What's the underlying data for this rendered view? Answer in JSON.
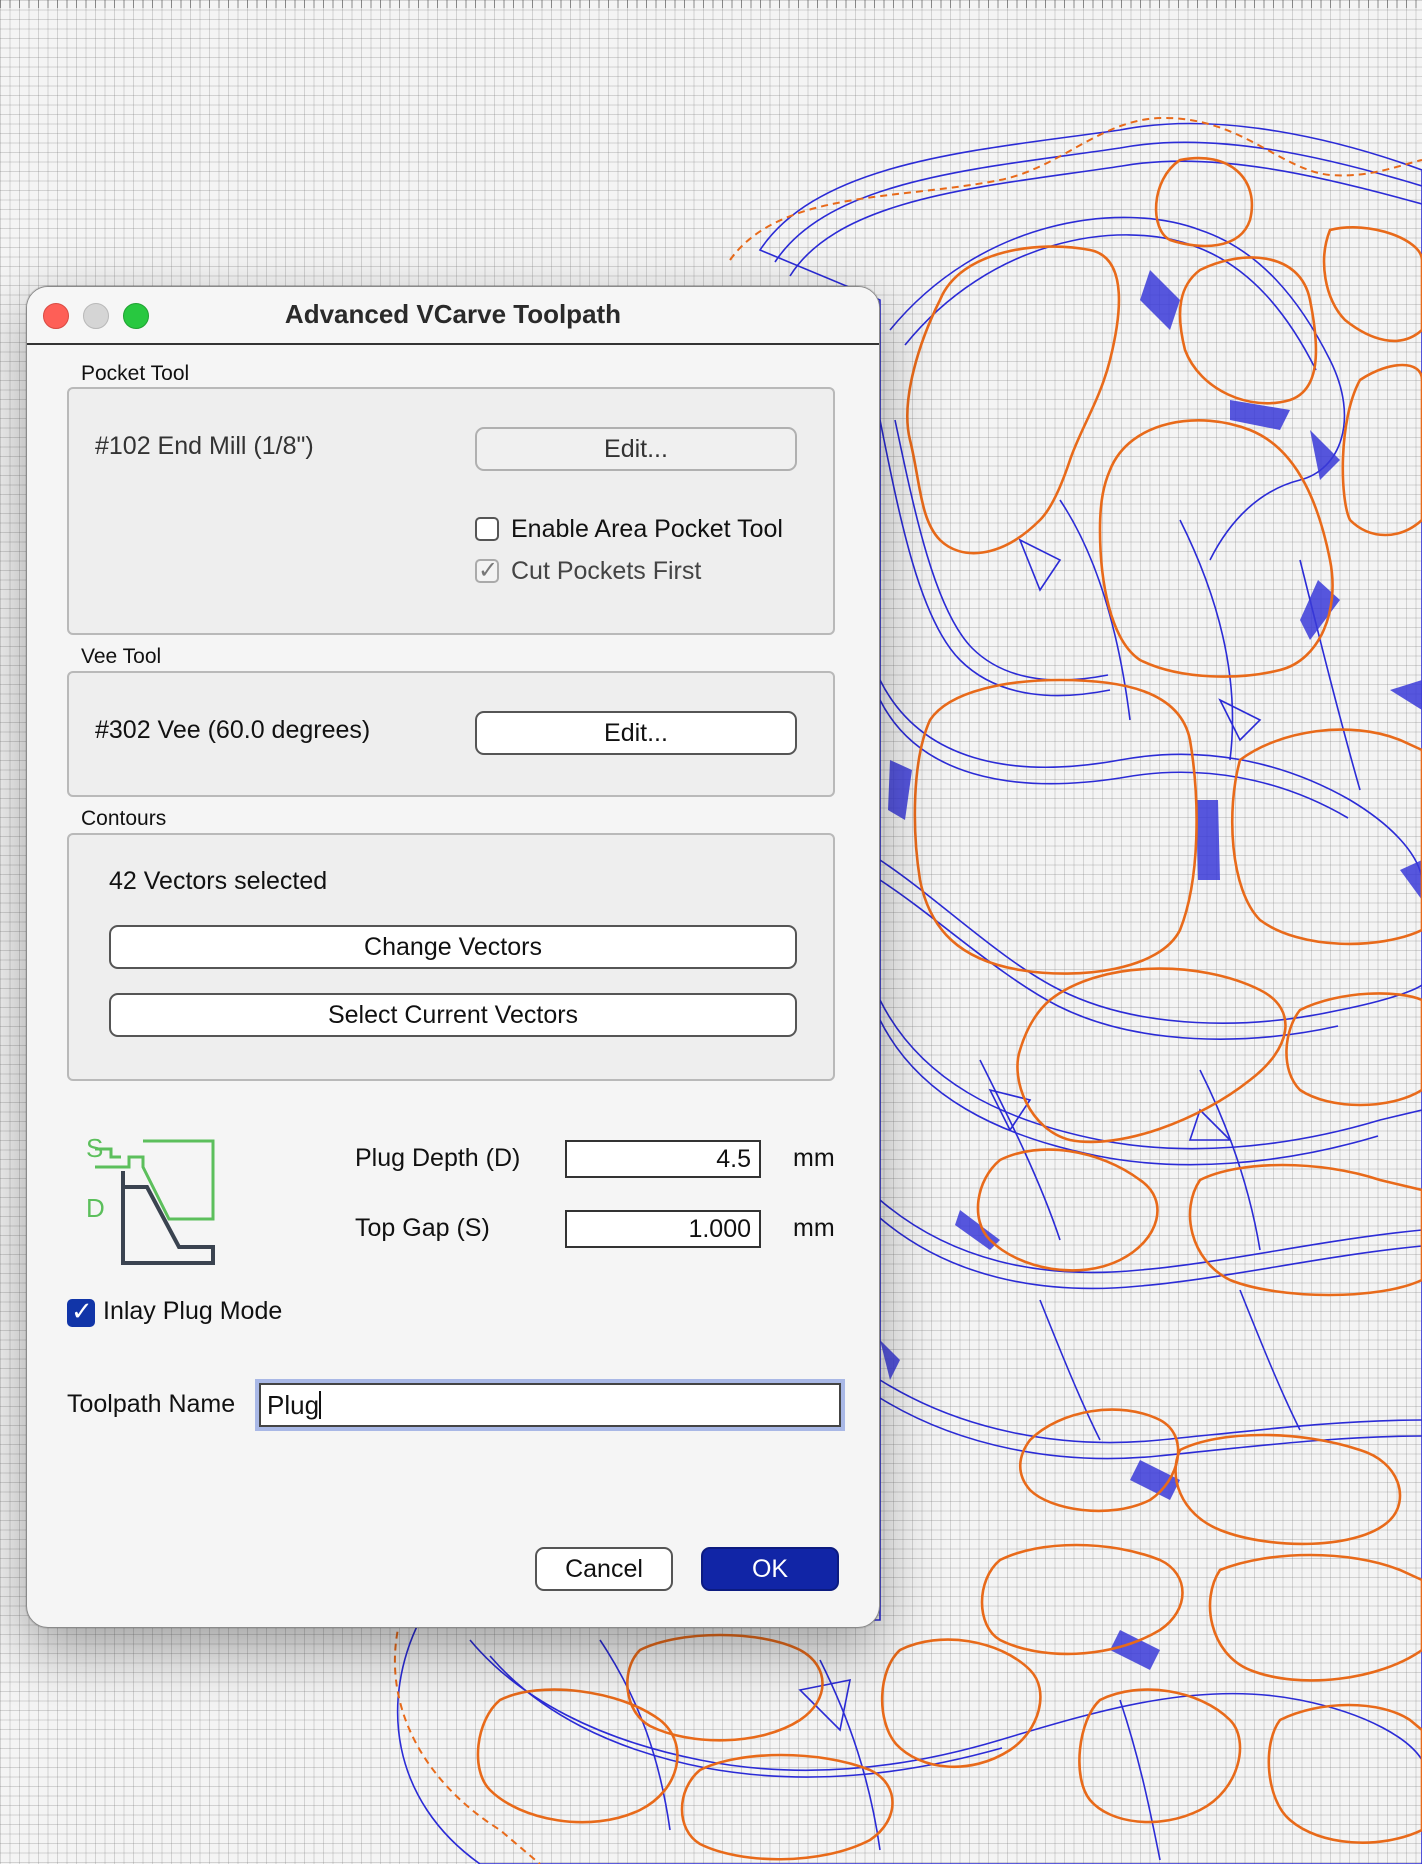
{
  "dialog": {
    "title": "Advanced VCarve Toolpath",
    "pocket_tool": {
      "group_label": "Pocket Tool",
      "tool_name": "#102 End Mill (1/8\")",
      "edit_label": "Edit...",
      "enable_area_label": "Enable Area Pocket Tool",
      "enable_area_checked": false,
      "cut_pockets_first_label": "Cut Pockets First",
      "cut_pockets_first_checked": true
    },
    "vee_tool": {
      "group_label": "Vee Tool",
      "tool_name": "#302 Vee (60.0 degrees)",
      "edit_label": "Edit..."
    },
    "contours": {
      "group_label": "Contours",
      "status": "42 Vectors selected",
      "change_label": "Change Vectors",
      "select_current_label": "Select Current Vectors"
    },
    "diagram": {
      "s_label": "S",
      "d_label": "D"
    },
    "plug_depth": {
      "label": "Plug Depth (D)",
      "value": "4.5",
      "unit": "mm"
    },
    "top_gap": {
      "label": "Top Gap (S)",
      "value": "1.000",
      "unit": "mm"
    },
    "inlay_plug_mode": {
      "label": "Inlay Plug Mode",
      "checked": true
    },
    "toolpath_name": {
      "label": "Toolpath Name",
      "value": "Plug"
    },
    "cancel_label": "Cancel",
    "ok_label": "OK"
  },
  "colors": {
    "vector_blue": "#2b2bd6",
    "toolpath_orange": "#e86a1a",
    "ok_button": "#1125a6",
    "diagram_green": "#5cbf5c",
    "diagram_dark": "#3a4350"
  }
}
